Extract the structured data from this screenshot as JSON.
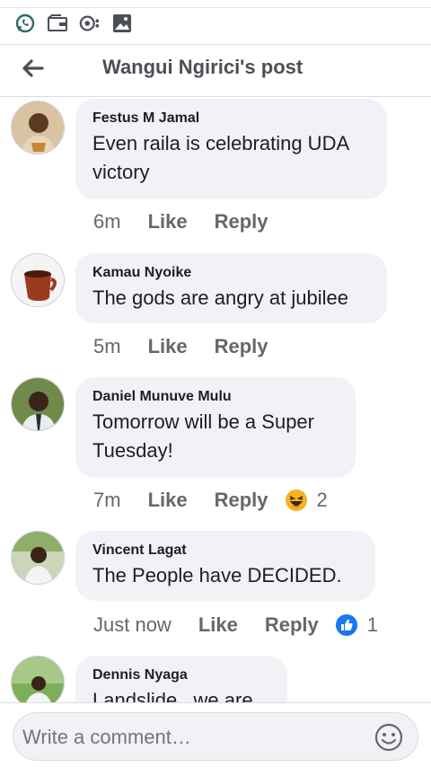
{
  "status_bar": {
    "icons": [
      "whatsapp-icon",
      "wallet-icon",
      "settings-dot-icon",
      "image-icon"
    ]
  },
  "header": {
    "title": "Wangui Ngirici's post",
    "back_icon": "arrow-left-icon"
  },
  "comments": [
    {
      "author": "Festus M Jamal",
      "text_lines": [
        "Even raila is celebrating UDA",
        "victory"
      ],
      "time": "6m",
      "like": "Like",
      "reply": "Reply",
      "reaction": null,
      "reaction_count": ""
    },
    {
      "author": "Kamau Nyoike",
      "text_lines": [
        "The gods are angry at jubilee"
      ],
      "time": "5m",
      "like": "Like",
      "reply": "Reply",
      "reaction": null,
      "reaction_count": ""
    },
    {
      "author": "Daniel Munuve Mulu",
      "text_lines": [
        "Tomorrow will be a Super",
        "Tuesday!"
      ],
      "time": "7m",
      "like": "Like",
      "reply": "Reply",
      "reaction": "haha-icon",
      "reaction_count": "2"
    },
    {
      "author": "Vincent Lagat",
      "text_lines": [
        "The People have DECIDED."
      ],
      "time": "Just now",
      "like": "Like",
      "reply": "Reply",
      "reaction": "like-icon",
      "reaction_count": "1"
    },
    {
      "author": "Dennis Nyaga",
      "text_lines": [
        "Landslide...we are"
      ],
      "time": "",
      "like": "",
      "reply": "",
      "reaction": null,
      "reaction_count": ""
    }
  ],
  "composer": {
    "placeholder": "Write a comment…",
    "emoji_icon": "smiley-icon"
  },
  "colors": {
    "bubble": "#f0f2f5",
    "meta_text": "#65676b",
    "like_blue": "#1877f2",
    "haha_yellow": "#f7b125"
  }
}
